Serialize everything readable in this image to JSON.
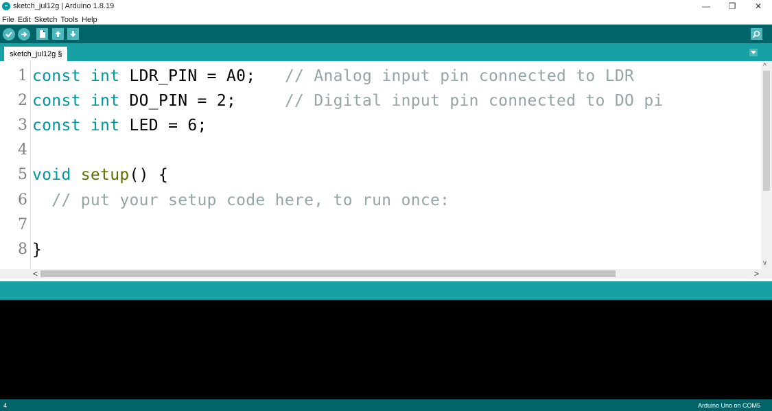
{
  "window": {
    "title": "sketch_jul12g | Arduino 1.8.19",
    "app_icon_text": "∞",
    "minimize_glyph": "—",
    "maximize_glyph": "❐",
    "close_glyph": "✕"
  },
  "menu": {
    "items": [
      "File",
      "Edit",
      "Sketch",
      "Tools",
      "Help"
    ]
  },
  "toolbar": {
    "buttons": [
      {
        "name": "verify",
        "icon": "check-icon"
      },
      {
        "name": "upload",
        "icon": "arrow-right-icon"
      },
      {
        "name": "new",
        "icon": "new-file-icon"
      },
      {
        "name": "open",
        "icon": "arrow-up-icon"
      },
      {
        "name": "save",
        "icon": "arrow-down-icon"
      },
      {
        "name": "serial-monitor",
        "icon": "magnifier-icon"
      }
    ]
  },
  "tabs": {
    "active": "sketch_jul12g §"
  },
  "editor": {
    "line_numbers": [
      "1",
      "2",
      "3",
      "4",
      "5",
      "6",
      "7",
      "8"
    ],
    "lines": [
      {
        "kw1": "const",
        "kw2": "int",
        "text": " LDR_PIN = A0;   ",
        "comment": "// Analog input pin connected to LDR"
      },
      {
        "kw1": "const",
        "kw2": "int",
        "text": " DO_PIN = 2;     ",
        "comment": "// Digital input pin connected to DO pi"
      },
      {
        "kw1": "const",
        "kw2": "int",
        "text": " LED = 6;",
        "comment": ""
      },
      {
        "text": ""
      },
      {
        "kw1": "void",
        "fn": "setup",
        "text": "() {"
      },
      {
        "comment": "  // put your setup code here, to run once:"
      },
      {
        "text": ""
      },
      {
        "text": "}"
      }
    ]
  },
  "scrollbars": {
    "left_arrow": "<",
    "right_arrow": ">",
    "up_arrow": "^",
    "down_arrow": "v"
  },
  "status": {
    "line": "4",
    "board": "Arduino Uno on COM5"
  },
  "colors": {
    "toolbar": "#006468",
    "tabstrip": "#17a1a5",
    "keyword": "#00979c",
    "function": "#5e6d03",
    "comment": "#95a5a6",
    "console": "#000000"
  }
}
